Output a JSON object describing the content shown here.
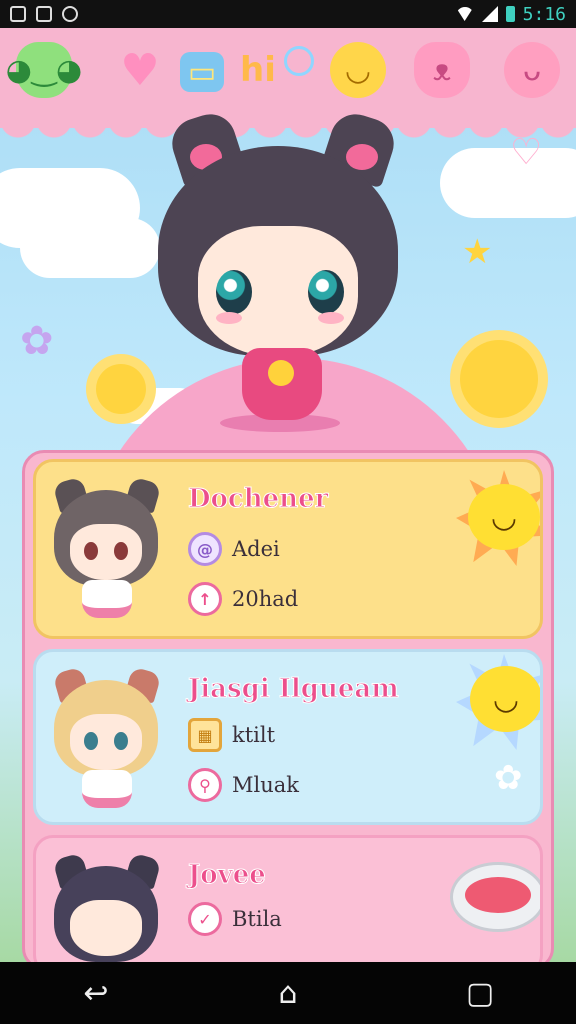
{
  "status_bar": {
    "time": "5:16",
    "left_icons": [
      "gallery-icon",
      "bag-icon",
      "sync-icon"
    ],
    "right_icons": [
      "wifi-icon",
      "signal-icon",
      "battery-icon"
    ]
  },
  "top_bar": {
    "icons": [
      "green-blob-icon",
      "heart-icon",
      "folder-icon",
      "hi-sticker-icon",
      "lemon-icon",
      "cat-icon",
      "pig-icon"
    ],
    "hi_text": "hi"
  },
  "cards": [
    {
      "name": "Dochener",
      "detail1": "Adei",
      "detail2": "20had",
      "detail1_icon": "swirl-icon",
      "detail2_icon": "arrow-up-icon"
    },
    {
      "name": "Jiasgi Ilgueam",
      "detail1": "ktilt",
      "detail2": "Mluak",
      "detail1_icon": "gift-icon",
      "detail2_icon": "location-icon"
    },
    {
      "name": "Jovee",
      "detail1": "Btila",
      "detail1_icon": "check-icon"
    }
  ],
  "nav": {
    "back": "back-icon",
    "home": "home-icon",
    "recents": "recents-icon"
  },
  "colors": {
    "accent": "#ec4f8c",
    "panel": "#f9b7cf",
    "card1": "#fde08a",
    "card2": "#cfeefa",
    "card3": "#fbc0d6"
  }
}
